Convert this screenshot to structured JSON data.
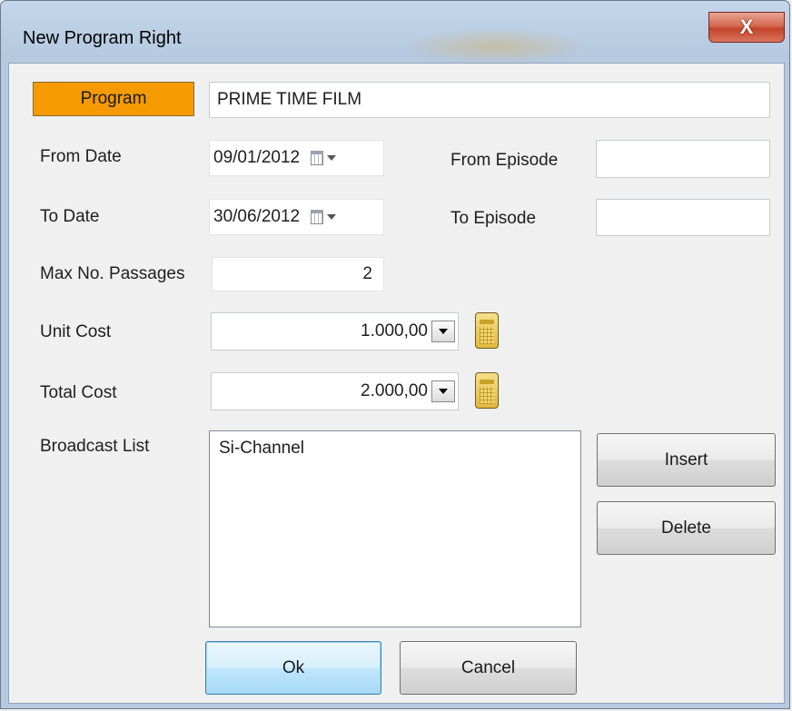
{
  "window": {
    "title": "New Program Right",
    "close_glyph": "X"
  },
  "program": {
    "button_label": "Program",
    "value": "PRIME TIME FILM"
  },
  "from_date": {
    "label": "From Date",
    "value": "09/01/2012"
  },
  "to_date": {
    "label": "To Date",
    "value": "30/06/2012"
  },
  "from_episode": {
    "label": "From Episode",
    "value": ""
  },
  "to_episode": {
    "label": "To Episode",
    "value": ""
  },
  "max_passages": {
    "label": "Max No. Passages",
    "value": "2"
  },
  "unit_cost": {
    "label": "Unit Cost",
    "value": "1.000,00"
  },
  "total_cost": {
    "label": "Total Cost",
    "value": "2.000,00"
  },
  "broadcast": {
    "label": "Broadcast List",
    "items": [
      "Si-Channel"
    ]
  },
  "buttons": {
    "insert": "Insert",
    "delete": "Delete",
    "ok": "Ok",
    "cancel": "Cancel"
  },
  "colors": {
    "program_button": "#f59a00",
    "close_button": "#c3442b",
    "calculator": "#e2b93d"
  },
  "icons": {
    "calendar": "calendar-icon",
    "calculator": "calculator-icon",
    "dropdown": "chevron-down-icon",
    "close": "close-icon"
  }
}
